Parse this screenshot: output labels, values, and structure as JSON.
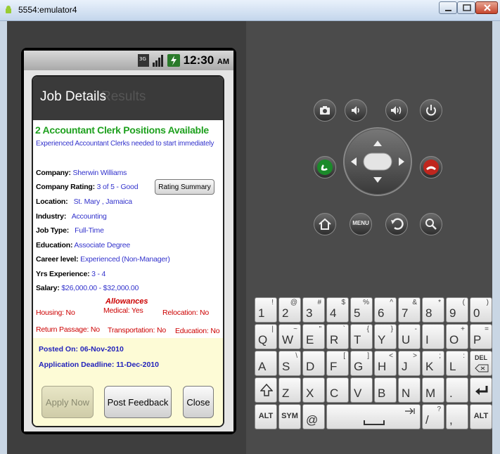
{
  "window": {
    "title": "5554:emulator4"
  },
  "statusbar": {
    "time": "12:30",
    "ampm": "AM"
  },
  "dialog": {
    "title": "Job Details",
    "behind_text": "Results",
    "headline": "2 Accountant Clerk Positions Available",
    "subhead": "Experienced Accountant Clerks needed to start immediately",
    "fields": [
      {
        "key": "Company:",
        "value": "Sherwin Williams"
      },
      {
        "key": "Company Rating:",
        "value": "3 of 5 - Good"
      },
      {
        "key": "Location:",
        "value": "St. Mary , Jamaica"
      },
      {
        "key": "Industry:",
        "value": "Accounting"
      },
      {
        "key": "Job Type:",
        "value": "Full-Time"
      },
      {
        "key": "Education:",
        "value": "Associate Degree"
      },
      {
        "key": "Career level:",
        "value": "Experienced (Non-Manager)"
      },
      {
        "key": "Yrs Experience:",
        "value": "3 - 4"
      },
      {
        "key": "Salary:",
        "value": "$26,000.00 - $32,000.00"
      }
    ],
    "rating_button": "Rating Summary",
    "allowances_title": "Allowances",
    "allowances": {
      "housing": "Housing: No",
      "medical": "Medical: Yes",
      "relocation": "Relocation: No",
      "return_passage": "Return Passage: No",
      "transportation": "Transportation: No",
      "education": "Education: No"
    },
    "posted_on": "Posted On: 06-Nov-2010",
    "deadline": "Application Deadline: 11-Dec-2010",
    "buttons": {
      "apply": "Apply Now",
      "feedback": "Post Feedback",
      "close": "Close"
    }
  },
  "keyboard": {
    "row1": [
      {
        "m": "1",
        "s": "!"
      },
      {
        "m": "2",
        "s": "@"
      },
      {
        "m": "3",
        "s": "#"
      },
      {
        "m": "4",
        "s": "$"
      },
      {
        "m": "5",
        "s": "%"
      },
      {
        "m": "6",
        "s": "^"
      },
      {
        "m": "7",
        "s": "&"
      },
      {
        "m": "8",
        "s": "*"
      },
      {
        "m": "9",
        "s": "("
      },
      {
        "m": "0",
        "s": ")"
      }
    ],
    "row2": [
      {
        "m": "Q",
        "s": "|"
      },
      {
        "m": "W",
        "s": "~"
      },
      {
        "m": "E",
        "s": "\""
      },
      {
        "m": "R",
        "s": "`"
      },
      {
        "m": "T",
        "s": "{"
      },
      {
        "m": "Y",
        "s": "}"
      },
      {
        "m": "U",
        "s": "-"
      },
      {
        "m": "I",
        "s": ""
      },
      {
        "m": "O",
        "s": "+"
      },
      {
        "m": "P",
        "s": "="
      }
    ],
    "row3": [
      {
        "m": "A",
        "s": ""
      },
      {
        "m": "S",
        "s": "\\"
      },
      {
        "m": "D",
        "s": ""
      },
      {
        "m": "F",
        "s": "["
      },
      {
        "m": "G",
        "s": "]"
      },
      {
        "m": "H",
        "s": "<"
      },
      {
        "m": "J",
        "s": ">"
      },
      {
        "m": "K",
        "s": ";"
      },
      {
        "m": "L",
        "s": ":"
      }
    ],
    "del": "DEL",
    "row4": [
      {
        "m": "Z",
        "s": ""
      },
      {
        "m": "X",
        "s": ""
      },
      {
        "m": "C",
        "s": ""
      },
      {
        "m": "V",
        "s": ""
      },
      {
        "m": "B",
        "s": ""
      },
      {
        "m": "N",
        "s": ""
      },
      {
        "m": "M",
        "s": ""
      },
      {
        "m": ".",
        "s": ""
      }
    ],
    "alt": "ALT",
    "sym": "SYM",
    "at": "@",
    "slash": "/",
    "slash_sub": "?",
    "comma": ","
  },
  "controls": {
    "menu": "MENU"
  }
}
